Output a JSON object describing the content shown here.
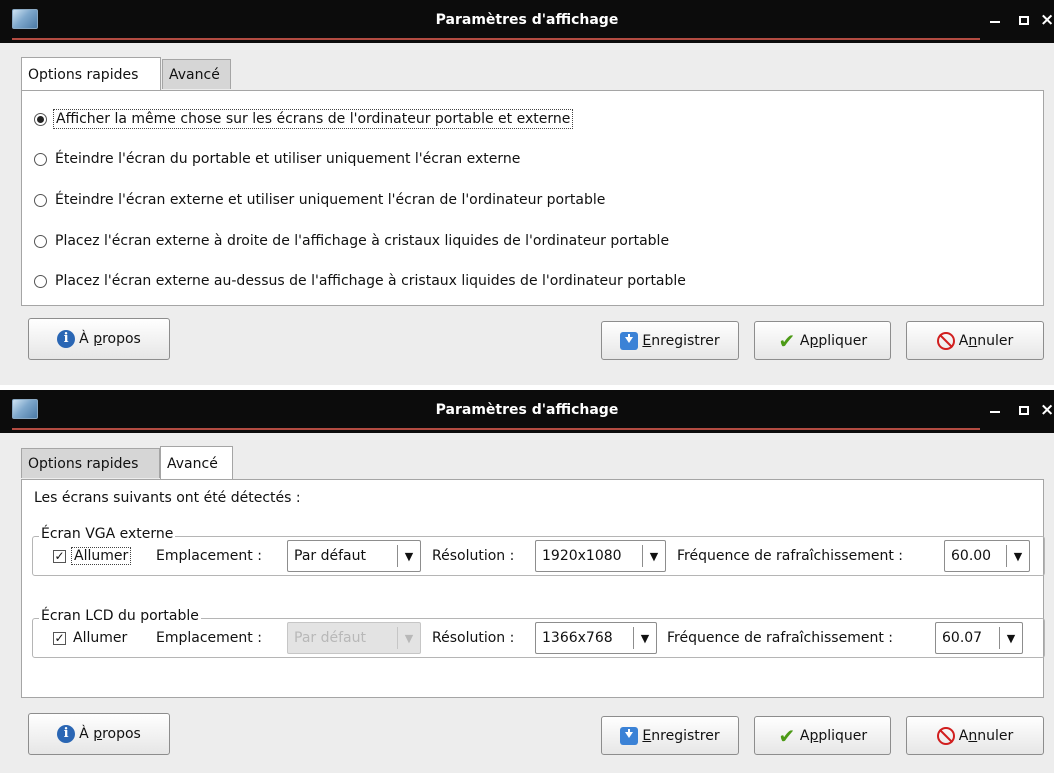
{
  "windows": {
    "quick": {
      "title": "Paramètres d'affichage",
      "tabs": [
        "Options rapides",
        "Avancé"
      ],
      "radio_options": [
        "Afficher la même chose sur les écrans de l'ordinateur portable et externe",
        "Éteindre l'écran du portable et utiliser uniquement l'écran externe",
        "Éteindre l'écran externe et utiliser uniquement l'écran de l'ordinateur portable",
        "Placez l'écran externe à droite de l'affichage à cristaux liquides de l'ordinateur portable",
        "Placez l'écran externe au-dessus de l'affichage à cristaux liquides de l'ordinateur portable"
      ],
      "selected_option_index": 0,
      "buttons": {
        "about": {
          "pre": "À ",
          "mn": "p",
          "post": "ropos"
        },
        "save": {
          "pre": "",
          "mn": "E",
          "post": "nregistrer"
        },
        "apply": {
          "pre": "A",
          "mn": "p",
          "post": "pliquer"
        },
        "cancel": {
          "pre": "A",
          "mn": "n",
          "post": "nuler"
        }
      }
    },
    "advanced": {
      "title": "Paramètres d'affichage",
      "tabs": [
        "Options rapides",
        "Avancé"
      ],
      "detected_text": "Les écrans suivants ont été détectés :",
      "screens": [
        {
          "group_title": "Écran VGA externe",
          "enabled": true,
          "enable_label": "Allumer",
          "location_label": "Emplacement :",
          "location_value": "Par défaut",
          "location_disabled": false,
          "resolution_label": "Résolution :",
          "resolution_value": "1920x1080",
          "refresh_label": "Fréquence de rafraîchissement :",
          "refresh_value": "60.00"
        },
        {
          "group_title": "Écran LCD du portable",
          "enabled": true,
          "enable_label": "Allumer",
          "location_label": "Emplacement :",
          "location_value": "Par défaut",
          "location_disabled": true,
          "resolution_label": "Résolution :",
          "resolution_value": "1366x768",
          "refresh_label": "Fréquence de rafraîchissement :",
          "refresh_value": "60.07"
        }
      ],
      "buttons": {
        "about": {
          "pre": "À ",
          "mn": "p",
          "post": "ropos"
        },
        "save": {
          "pre": "",
          "mn": "E",
          "post": "nregistrer"
        },
        "apply": {
          "pre": "A",
          "mn": "p",
          "post": "pliquer"
        },
        "cancel": {
          "pre": "A",
          "mn": "n",
          "post": "nuler"
        }
      }
    }
  },
  "icons": {
    "app": "display-settings-icon",
    "about": "info-icon",
    "save": "save-download-icon",
    "apply": "checkmark-icon",
    "cancel": "cancel-circle-icon",
    "dropdown": "triangle-down-icon"
  },
  "colors": {
    "titlebar_bg": "#0c0c0c",
    "title_underline": "#b44c42",
    "window_bg": "#ededed",
    "panel_bg": "#ffffff",
    "info_blue": "#2a66b4",
    "save_blue": "#3b82d6",
    "apply_green": "#4c9a16",
    "cancel_red": "#d11f1f"
  }
}
